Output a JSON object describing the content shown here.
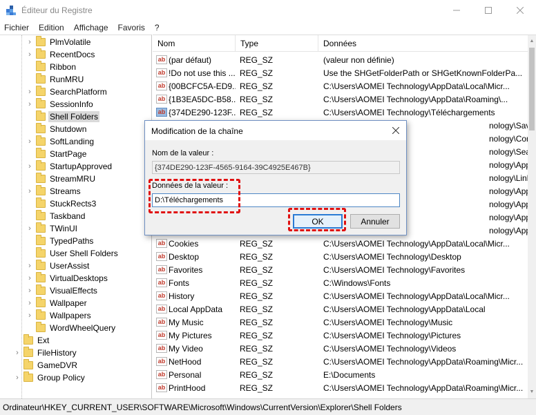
{
  "window": {
    "title": "Éditeur du Registre"
  },
  "menu": [
    "Fichier",
    "Edition",
    "Affichage",
    "Favoris",
    "?"
  ],
  "tree": {
    "items": [
      {
        "label": "PlmVolatile",
        "expandable": true
      },
      {
        "label": "RecentDocs",
        "expandable": true
      },
      {
        "label": "Ribbon",
        "expandable": false
      },
      {
        "label": "RunMRU",
        "expandable": false
      },
      {
        "label": "SearchPlatform",
        "expandable": true
      },
      {
        "label": "SessionInfo",
        "expandable": true
      },
      {
        "label": "Shell Folders",
        "expandable": false,
        "selected": true
      },
      {
        "label": "Shutdown",
        "expandable": false
      },
      {
        "label": "SoftLanding",
        "expandable": true
      },
      {
        "label": "StartPage",
        "expandable": false
      },
      {
        "label": "StartupApproved",
        "expandable": true
      },
      {
        "label": "StreamMRU",
        "expandable": false
      },
      {
        "label": "Streams",
        "expandable": true
      },
      {
        "label": "StuckRects3",
        "expandable": false
      },
      {
        "label": "Taskband",
        "expandable": false
      },
      {
        "label": "TWinUI",
        "expandable": true
      },
      {
        "label": "TypedPaths",
        "expandable": false
      },
      {
        "label": "User Shell Folders",
        "expandable": false
      },
      {
        "label": "UserAssist",
        "expandable": true
      },
      {
        "label": "VirtualDesktops",
        "expandable": true
      },
      {
        "label": "VisualEffects",
        "expandable": true
      },
      {
        "label": "Wallpaper",
        "expandable": true
      },
      {
        "label": "Wallpapers",
        "expandable": true
      },
      {
        "label": "WordWheelQuery",
        "expandable": false
      },
      {
        "label": "Ext",
        "expandable": false,
        "level": 0
      },
      {
        "label": "FileHistory",
        "expandable": true,
        "level": 0
      },
      {
        "label": "GameDVR",
        "expandable": false,
        "level": 0
      },
      {
        "label": "Group Policy",
        "expandable": true,
        "level": 0
      }
    ]
  },
  "list": {
    "headers": {
      "name": "Nom",
      "type": "Type",
      "data": "Données"
    },
    "rows": [
      {
        "name": "(par défaut)",
        "type": "REG_SZ",
        "data": "(valeur non définie)"
      },
      {
        "name": "!Do not use this ...",
        "type": "REG_SZ",
        "data": "Use the SHGetFolderPath or SHGetKnownFolderPa..."
      },
      {
        "name": "{00BCFC5A-ED9...",
        "type": "REG_SZ",
        "data": "C:\\Users\\AOMEI Technology\\AppData\\Local\\Micr..."
      },
      {
        "name": "{1B3EA5DC-B58...",
        "type": "REG_SZ",
        "data": "C:\\Users\\AOMEI Technology\\AppData\\Roaming\\..."
      },
      {
        "name": "{374DE290-123F...",
        "type": "REG_SZ",
        "data": "C:\\Users\\AOMEI Technology\\Téléchargements",
        "selected": true
      },
      {
        "name": "",
        "type": "",
        "data": "nology\\Saved Games"
      },
      {
        "name": "",
        "type": "",
        "data": "nology\\Contacts"
      },
      {
        "name": "",
        "type": "",
        "data": "nology\\Searches"
      },
      {
        "name": "",
        "type": "",
        "data": "nology\\AppData\\LocalLow"
      },
      {
        "name": "",
        "type": "",
        "data": "nology\\Links"
      },
      {
        "name": "",
        "type": "",
        "data": "nology\\AppData\\Roaming\\..."
      },
      {
        "name": "",
        "type": "",
        "data": "nology\\AppData\\Roaming"
      },
      {
        "name": "",
        "type": "",
        "data": "nology\\AppData\\Local\\Micr..."
      },
      {
        "name": "",
        "type": "",
        "data": "nology\\AppData\\Roaming\\..."
      },
      {
        "name": "Cookies",
        "type": "REG_SZ",
        "data": "C:\\Users\\AOMEI Technology\\AppData\\Local\\Micr..."
      },
      {
        "name": "Desktop",
        "type": "REG_SZ",
        "data": "C:\\Users\\AOMEI Technology\\Desktop"
      },
      {
        "name": "Favorites",
        "type": "REG_SZ",
        "data": "C:\\Users\\AOMEI Technology\\Favorites"
      },
      {
        "name": "Fonts",
        "type": "REG_SZ",
        "data": "C:\\Windows\\Fonts"
      },
      {
        "name": "History",
        "type": "REG_SZ",
        "data": "C:\\Users\\AOMEI Technology\\AppData\\Local\\Micr..."
      },
      {
        "name": "Local AppData",
        "type": "REG_SZ",
        "data": "C:\\Users\\AOMEI Technology\\AppData\\Local"
      },
      {
        "name": "My Music",
        "type": "REG_SZ",
        "data": "C:\\Users\\AOMEI Technology\\Music"
      },
      {
        "name": "My Pictures",
        "type": "REG_SZ",
        "data": "C:\\Users\\AOMEI Technology\\Pictures"
      },
      {
        "name": "My Video",
        "type": "REG_SZ",
        "data": "C:\\Users\\AOMEI Technology\\Videos"
      },
      {
        "name": "NetHood",
        "type": "REG_SZ",
        "data": "C:\\Users\\AOMEI Technology\\AppData\\Roaming\\Micr..."
      },
      {
        "name": "Personal",
        "type": "REG_SZ",
        "data": "E:\\Documents"
      },
      {
        "name": "PrintHood",
        "type": "REG_SZ",
        "data": "C:\\Users\\AOMEI Technology\\AppData\\Roaming\\Micr..."
      }
    ]
  },
  "status": {
    "path": "Ordinateur\\HKEY_CURRENT_USER\\SOFTWARE\\Microsoft\\Windows\\CurrentVersion\\Explorer\\Shell Folders"
  },
  "dialog": {
    "title": "Modification de la chaîne",
    "value_name_label": "Nom de la valeur :",
    "value_name": "{374DE290-123F-4565-9164-39C4925E467B}",
    "value_data_label": "Données de la valeur :",
    "value_data": "D:\\Téléchargements",
    "ok_label": "OK",
    "cancel_label": "Annuler"
  },
  "colors": {
    "highlight": "#e01010",
    "accent": "#2a7bd5"
  }
}
